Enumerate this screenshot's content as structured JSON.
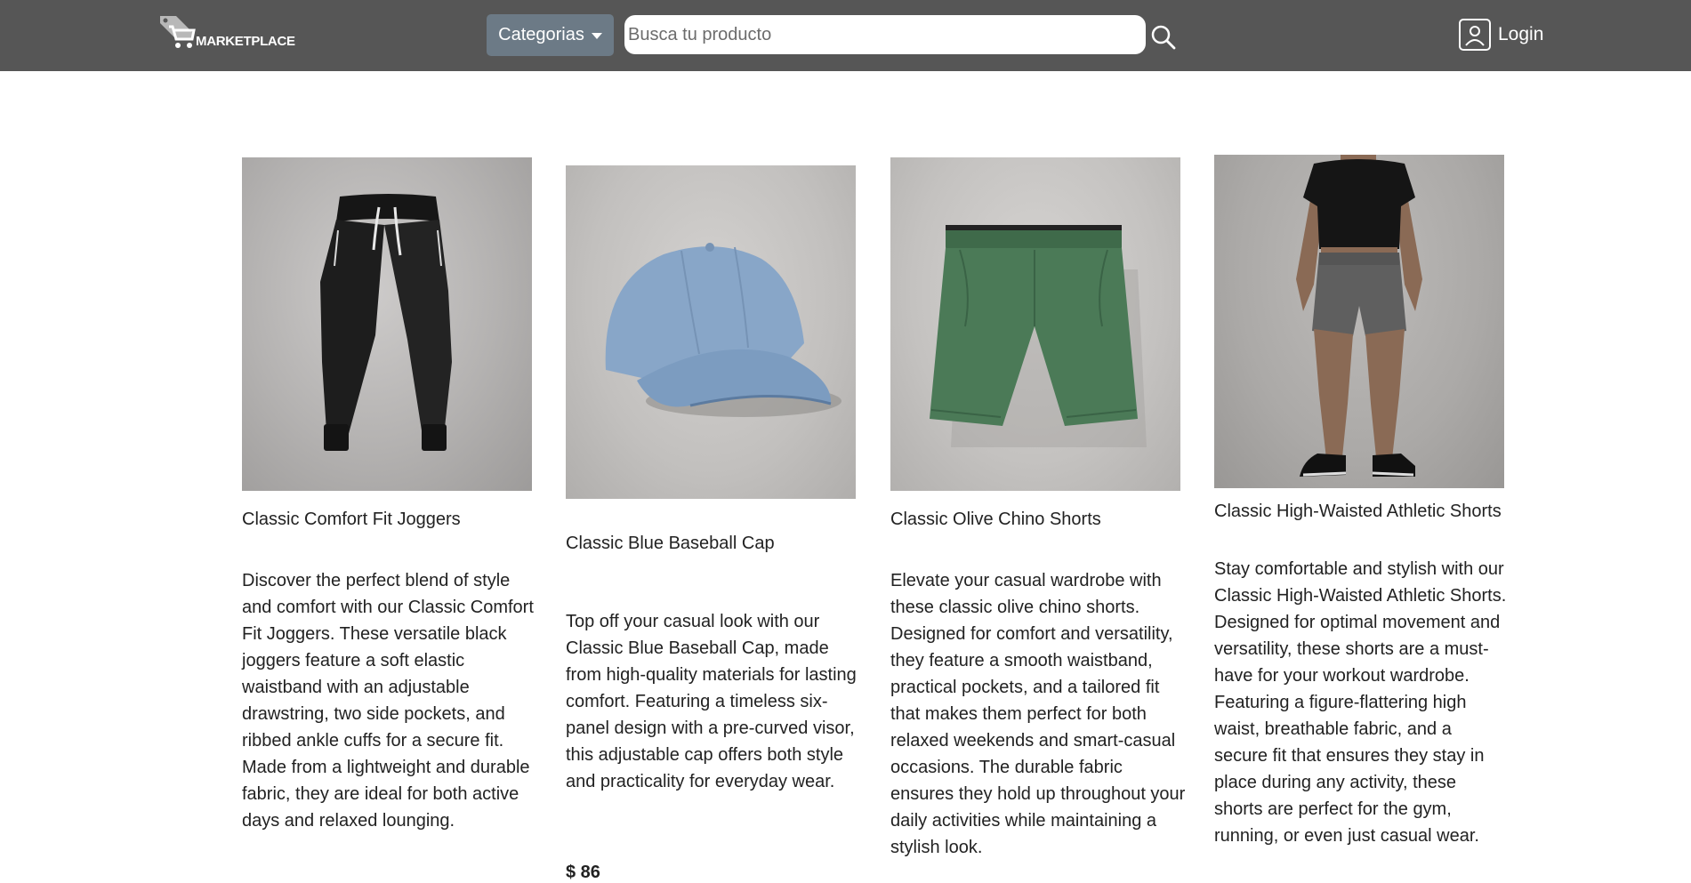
{
  "navbar": {
    "logo_text": "MARKETPLACE",
    "categories_label": "Categorias",
    "search_placeholder": "Busca tu producto",
    "login_label": "Login"
  },
  "colors": {
    "navbar_bg": "#565656",
    "categories_btn_bg": "#6c7a86"
  },
  "products": [
    {
      "name": "Classic Comfort Fit Joggers",
      "description": "Discover the perfect blend of style and comfort with our Classic Comfort Fit Joggers. These versatile black joggers feature a soft elastic waistband with an adjustable drawstring, two side pockets, and ribbed ankle cuffs for a secure fit. Made from a lightweight and durable fabric, they are ideal for both active days and relaxed lounging.",
      "image": "black-joggers-image"
    },
    {
      "name": "Classic Blue Baseball Cap",
      "description": "Top off your casual look with our Classic Blue Baseball Cap, made from high-quality materials for lasting comfort. Featuring a timeless six-panel design with a pre-curved visor, this adjustable cap offers both style and practicality for everyday wear.",
      "price": "$ 86",
      "image": "blue-cap-image"
    },
    {
      "name": "Classic Olive Chino Shorts",
      "description": "Elevate your casual wardrobe with these classic olive chino shorts. Designed for comfort and versatility, they feature a smooth waistband, practical pockets, and a tailored fit that makes them perfect for both relaxed weekends and smart-casual occasions. The durable fabric ensures they hold up throughout your daily activities while maintaining a stylish look.",
      "image": "olive-shorts-image"
    },
    {
      "name": "Classic High-Waisted Athletic Shorts",
      "description": "Stay comfortable and stylish with our Classic High-Waisted Athletic Shorts. Designed for optimal movement and versatility, these shorts are a must-have for your workout wardrobe. Featuring a figure-flattering high waist, breathable fabric, and a secure fit that ensures they stay in place during any activity, these shorts are perfect for the gym, running, or even just casual wear.",
      "image": "athletic-shorts-image"
    }
  ]
}
